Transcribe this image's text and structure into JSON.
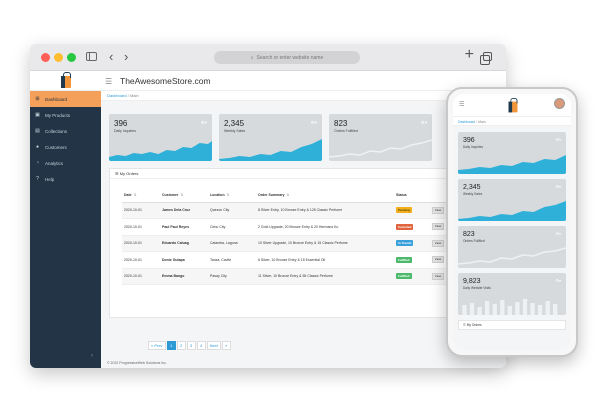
{
  "browser": {
    "address_placeholder": "Search or enter website name"
  },
  "app": {
    "title": "TheAwesomeStore.com",
    "breadcrumb": {
      "link": "Dashboard",
      "separator": "/",
      "current": "Main"
    },
    "footer": "© 2022 ProgressiveWeb Solutions Inc."
  },
  "sidebar": {
    "items": [
      {
        "label": "Dashboard",
        "icon": "dashboard-icon"
      },
      {
        "label": "My Products",
        "icon": "products-icon"
      },
      {
        "label": "Collections",
        "icon": "collections-icon"
      },
      {
        "label": "Customers",
        "icon": "customers-icon"
      },
      {
        "label": "Analytics",
        "icon": "analytics-icon"
      },
      {
        "label": "Help",
        "icon": "help-icon"
      }
    ]
  },
  "stats": [
    {
      "value": "396",
      "label": "Daily Inquiries",
      "color": "#2fb0d8"
    },
    {
      "value": "2,345",
      "label": "Weekly Sales",
      "color": "#2fb0d8"
    },
    {
      "value": "823",
      "label": "Orders Fulfilled",
      "color": "#eef1f3"
    }
  ],
  "orders": {
    "title": "My Orders",
    "columns": [
      "Date",
      "Customer",
      "Location",
      "Order Summary",
      "Status"
    ],
    "rows": [
      {
        "date": "2020-10-01",
        "customer": "James Dela Cruz",
        "location": "Quezon City",
        "summary": "8 Silver Entry, 10 Bronze Entry & 125 Classic Perfume",
        "status": "Pending",
        "action": "View"
      },
      {
        "date": "2020-10-01",
        "customer": "Paul Paul Reyes",
        "location": "Cebu City",
        "summary": "2 Gold Upgrade, 20 Bronze Entry & 20 Hermans Ko",
        "status": "Canceled",
        "action": "View"
      },
      {
        "date": "2020-10-01",
        "customer": "Eduardo Caluag",
        "location": "Calamba, Laguna",
        "summary": "10 Silver Upgrade, 10 Bronze Entry & 15 Classic Perfume",
        "status": "In Transit",
        "action": "View"
      },
      {
        "date": "2020-10-01",
        "customer": "Donie Gutapa",
        "location": "Tanza, Cavite",
        "summary": "6 Silver, 10 Bronze Entry & 15 Essential Oil",
        "status": "Fulfilled",
        "action": "View"
      },
      {
        "date": "2020-10-01",
        "customer": "Emma Bango",
        "location": "Pasay City",
        "summary": "11 Silver, 10 Bronze Entry & 55 Classic Perfume",
        "status": "Fulfilled",
        "action": "View"
      }
    ]
  },
  "pagination": [
    "« Prev",
    "1",
    "2",
    "3",
    "4",
    "Next",
    "»"
  ],
  "pagination_current": "1",
  "phone": {
    "breadcrumb": {
      "link": "Dashboard",
      "separator": "/",
      "current": "Main"
    },
    "stats": [
      {
        "value": "396",
        "label": "Daily Inquiries"
      },
      {
        "value": "2,345",
        "label": "Weekly Sales"
      },
      {
        "value": "823",
        "label": "Orders Fulfilled"
      },
      {
        "value": "9,823",
        "label": "Daily Website Visits"
      }
    ],
    "orders_title": "My Orders"
  }
}
